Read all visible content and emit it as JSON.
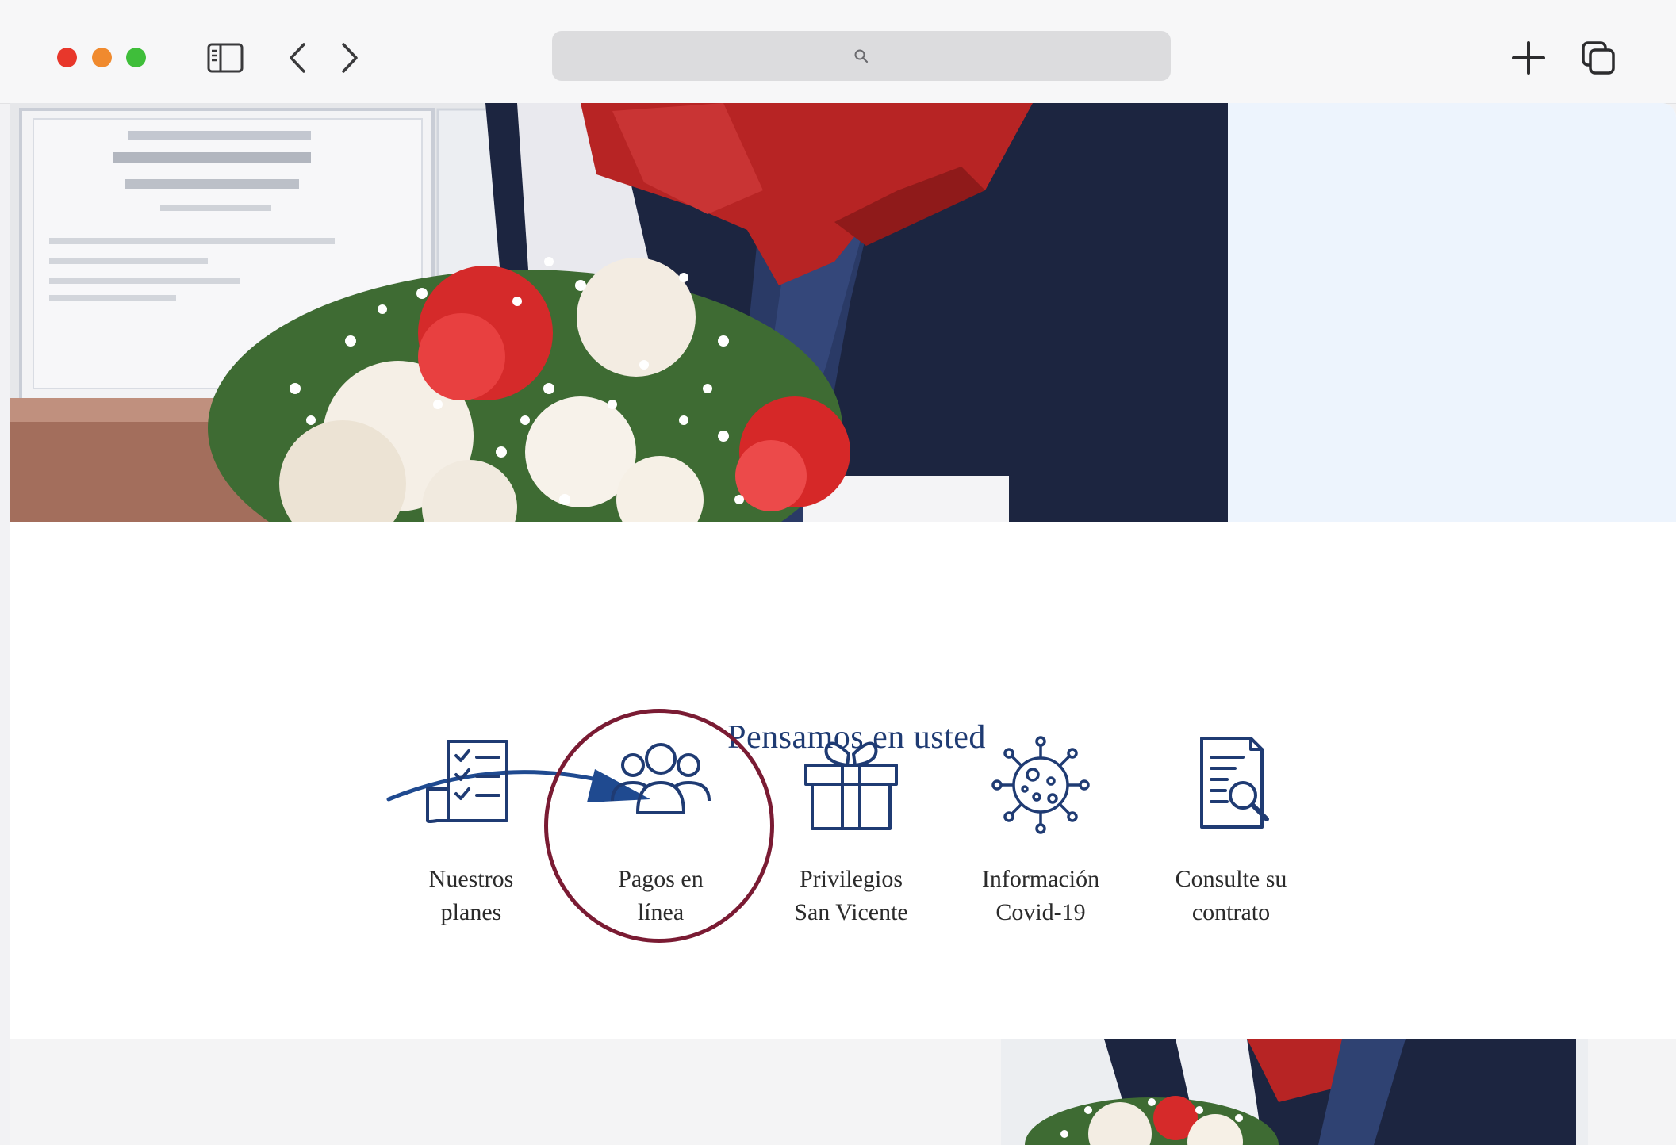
{
  "browser": {
    "icons": {
      "sidebar": "sidebar-icon",
      "back": "chevron-left-icon",
      "forward": "chevron-right-icon",
      "search": "search-icon",
      "new_tab": "plus-icon",
      "tabs": "tabs-overview-icon"
    },
    "colors": {
      "close": "#e8372b",
      "minimize": "#f08a2e",
      "zoom": "#3fbe3a"
    }
  },
  "page": {
    "section_title": "Pensamos en usted",
    "features": [
      {
        "label": "Nuestros\nplanes",
        "icon": "checklist-icon"
      },
      {
        "label": "Pagos en\nlínea",
        "icon": "people-group-icon"
      },
      {
        "label": "Privilegios\nSan Vicente",
        "icon": "gift-icon"
      },
      {
        "label": "Información\nCovid-19",
        "icon": "virus-icon"
      },
      {
        "label": "Consulte su\ncontrato",
        "icon": "document-search-icon"
      }
    ],
    "colors": {
      "brand_blue": "#1f3b73",
      "highlight": "#7a1b33",
      "hero_side": "#edf4fd"
    }
  }
}
